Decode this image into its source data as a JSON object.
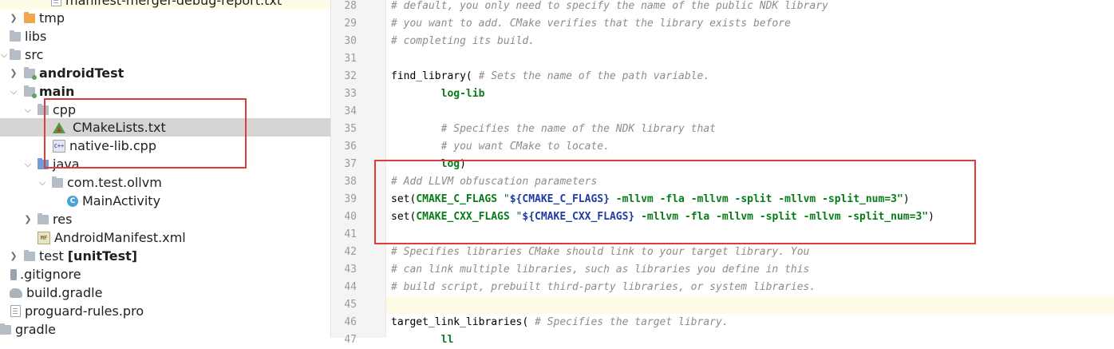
{
  "tree": {
    "items": [
      {
        "label": "manifest-merger-debug-report.txt"
      },
      {
        "label": "tmp"
      },
      {
        "label": "libs"
      },
      {
        "label": "src"
      },
      {
        "label": "androidTest"
      },
      {
        "label": "main"
      },
      {
        "label": "cpp"
      },
      {
        "label": "CMakeLists.txt"
      },
      {
        "label": "native-lib.cpp"
      },
      {
        "label": "java"
      },
      {
        "label": "com.test.ollvm"
      },
      {
        "label": "MainActivity"
      },
      {
        "label": "res"
      },
      {
        "label": "AndroidManifest.xml"
      },
      {
        "label": "test"
      },
      {
        "label": "[unitTest]"
      },
      {
        "label": ".gitignore"
      },
      {
        "label": "build.gradle"
      },
      {
        "label": "proguard-rules.pro"
      },
      {
        "label": "gradle"
      }
    ],
    "icon_text": {
      "cpp": "C++",
      "class": "C",
      "manifest": "MF"
    }
  },
  "editor": {
    "line_numbers": [
      "28",
      "29",
      "30",
      "31",
      "32",
      "33",
      "34",
      "35",
      "36",
      "37",
      "38",
      "39",
      "40",
      "41",
      "42",
      "43",
      "44",
      "45",
      "46",
      "47"
    ],
    "lines": {
      "l28": "# default, you only need to specify the name of the public NDK library",
      "l29": "# you want to add. CMake verifies that the library exists before",
      "l30": "# completing its build.",
      "l32_fn": "find_library(",
      "l32_cmt": " # Sets the name of the path variable.",
      "l33": "        log-lib",
      "l35": "        # Specifies the name of the NDK library that",
      "l36": "        # you want CMake to locate.",
      "l37_kw": "        log",
      "l37_tx": ")",
      "l38": "# Add LLVM obfuscation parameters",
      "l39_a": "set(",
      "l39_b": "CMAKE_C_FLAGS",
      "l39_c": " \"",
      "l39_d": "${CMAKE_C_FLAGS}",
      "l39_e": " -mllvm -fla -mllvm -split -mllvm -split_num=3\"",
      "l39_f": ")",
      "l40_a": "set(",
      "l40_b": "CMAKE_CXX_FLAGS",
      "l40_c": " \"",
      "l40_d": "${CMAKE_CXX_FLAGS}",
      "l40_e": " -mllvm -fla -mllvm -split -mllvm -split_num=3\"",
      "l40_f": ")",
      "l42": "# Specifies libraries CMake should link to your target library. You",
      "l43": "# can link multiple libraries, such as libraries you define in this",
      "l44": "# build script, prebuilt third-party libraries, or system libraries.",
      "l46_fn": "target_link_libraries(",
      "l46_cmt": " # Specifies the target library.",
      "l47": "        ll"
    }
  },
  "colors": {
    "annotation_box": "#e03a3a",
    "comment": "#8c8c8c",
    "keyword": "#067d17",
    "variable": "#1f3ba6",
    "selection": "#d5d5d5",
    "current_line": "#fefbe6"
  }
}
